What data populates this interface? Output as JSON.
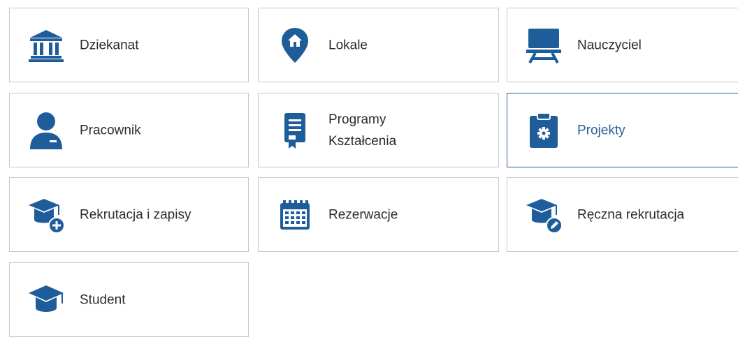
{
  "colors": {
    "icon": "#1f5d9a",
    "border": "#c8c8c8",
    "active_border": "#2e5f9a",
    "text": "#2c2c2c"
  },
  "tiles": [
    {
      "label": "Dziekanat",
      "icon": "university-icon"
    },
    {
      "label": "Lokale",
      "icon": "location-home-icon"
    },
    {
      "label": "Nauczyciel",
      "icon": "teacher-board-icon"
    },
    {
      "label": "Pracownik",
      "icon": "employee-icon"
    },
    {
      "label": "Programy\nKształcenia",
      "icon": "document-bookmark-icon"
    },
    {
      "label": "Projekty",
      "icon": "clipboard-gear-icon",
      "active": true
    },
    {
      "label": "Rekrutacja i zapisy",
      "icon": "graduation-cap-plus-icon"
    },
    {
      "label": "Rezerwacje",
      "icon": "calendar-icon"
    },
    {
      "label": "Ręczna rekrutacja",
      "icon": "graduation-cap-edit-icon"
    },
    {
      "label": "Student",
      "icon": "graduation-cap-icon"
    }
  ]
}
